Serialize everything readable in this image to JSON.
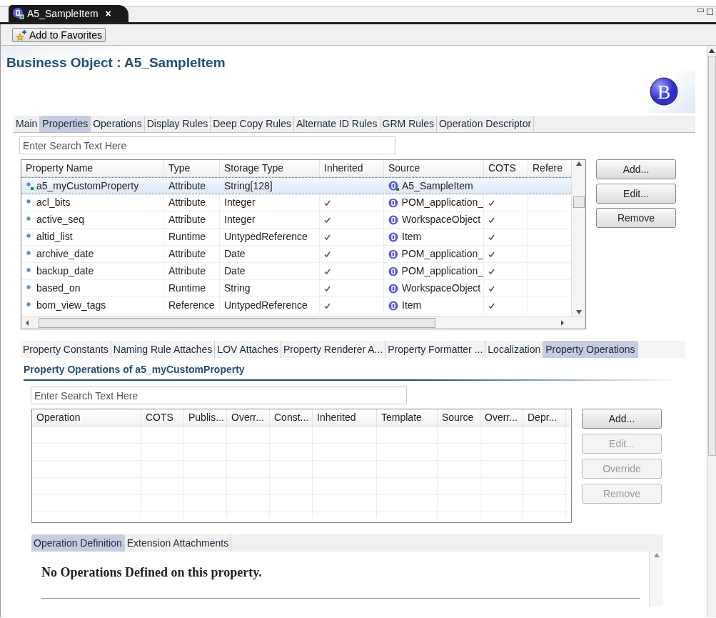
{
  "editor_tab": {
    "title": "A5_SampleItem",
    "close": "×"
  },
  "toolbar": {
    "favorites_button": "Add to Favorites"
  },
  "title": "Business Object : A5_SampleItem",
  "logo": {
    "letter": "B"
  },
  "main_tabs": [
    {
      "label": "Main",
      "selected": false
    },
    {
      "label": "Properties",
      "selected": true
    },
    {
      "label": "Operations",
      "selected": false
    },
    {
      "label": "Display Rules",
      "selected": false
    },
    {
      "label": "Deep Copy Rules",
      "selected": false
    },
    {
      "label": "Alternate ID Rules",
      "selected": false
    },
    {
      "label": "GRM Rules",
      "selected": false
    },
    {
      "label": "Operation Descriptor",
      "selected": false
    }
  ],
  "properties_search": {
    "placeholder": "Enter Search Text Here"
  },
  "properties_table": {
    "columns": [
      "Property Name",
      "Type",
      "Storage Type",
      "Inherited",
      "Source",
      "COTS",
      "Refere"
    ],
    "rows": [
      {
        "name": "a5_myCustomProperty",
        "type": "Attribute",
        "storage": "String[128]",
        "inherited": false,
        "source": "A5_SampleItem",
        "custom": true,
        "cots": false,
        "selected": true
      },
      {
        "name": "acl_bits",
        "type": "Attribute",
        "storage": "Integer",
        "inherited": true,
        "source": "POM_application_",
        "custom": false,
        "cots": true,
        "selected": false
      },
      {
        "name": "active_seq",
        "type": "Attribute",
        "storage": "Integer",
        "inherited": true,
        "source": "WorkspaceObject",
        "custom": false,
        "cots": true,
        "selected": false
      },
      {
        "name": "altid_list",
        "type": "Runtime",
        "storage": "UntypedReference",
        "inherited": true,
        "source": "Item",
        "custom": false,
        "cots": true,
        "selected": false
      },
      {
        "name": "archive_date",
        "type": "Attribute",
        "storage": "Date",
        "inherited": true,
        "source": "POM_application_",
        "custom": false,
        "cots": true,
        "selected": false
      },
      {
        "name": "backup_date",
        "type": "Attribute",
        "storage": "Date",
        "inherited": true,
        "source": "POM_application_",
        "custom": false,
        "cots": true,
        "selected": false
      },
      {
        "name": "based_on",
        "type": "Runtime",
        "storage": "String",
        "inherited": true,
        "source": "WorkspaceObject",
        "custom": false,
        "cots": true,
        "selected": false
      },
      {
        "name": "bom_view_tags",
        "type": "Reference",
        "storage": "UntypedReference",
        "inherited": true,
        "source": "Item",
        "custom": false,
        "cots": true,
        "selected": false
      }
    ]
  },
  "properties_buttons": [
    {
      "label": "Add...",
      "disabled": false
    },
    {
      "label": "Edit...",
      "disabled": false
    },
    {
      "label": "Remove",
      "disabled": false
    }
  ],
  "property_tabs": [
    {
      "label": "Property Constants",
      "selected": false
    },
    {
      "label": "Naming Rule Attaches",
      "selected": false
    },
    {
      "label": "LOV Attaches",
      "selected": false
    },
    {
      "label": "Property Renderer A...",
      "selected": false
    },
    {
      "label": "Property Formatter ...",
      "selected": false
    },
    {
      "label": "Localization",
      "selected": false
    },
    {
      "label": "Property Operations",
      "selected": true
    }
  ],
  "section_heading": "Property Operations of a5_myCustomProperty",
  "operations_search": {
    "placeholder": "Enter Search Text Here"
  },
  "operations_table": {
    "columns": [
      "Operation",
      "COTS",
      "Publis...",
      "Overr...",
      "Const...",
      "Inherited",
      "Template",
      "Source",
      "Overr...",
      "Depr..."
    ]
  },
  "operations_buttons": [
    {
      "label": "Add...",
      "disabled": false
    },
    {
      "label": "Edit...",
      "disabled": true
    },
    {
      "label": "Override",
      "disabled": true
    },
    {
      "label": "Remove",
      "disabled": true
    }
  ],
  "definition_tabs": [
    {
      "label": "Operation Definition",
      "selected": true
    },
    {
      "label": "Extension Attachments",
      "selected": false
    }
  ],
  "definition_message": "No Operations Defined on this property."
}
